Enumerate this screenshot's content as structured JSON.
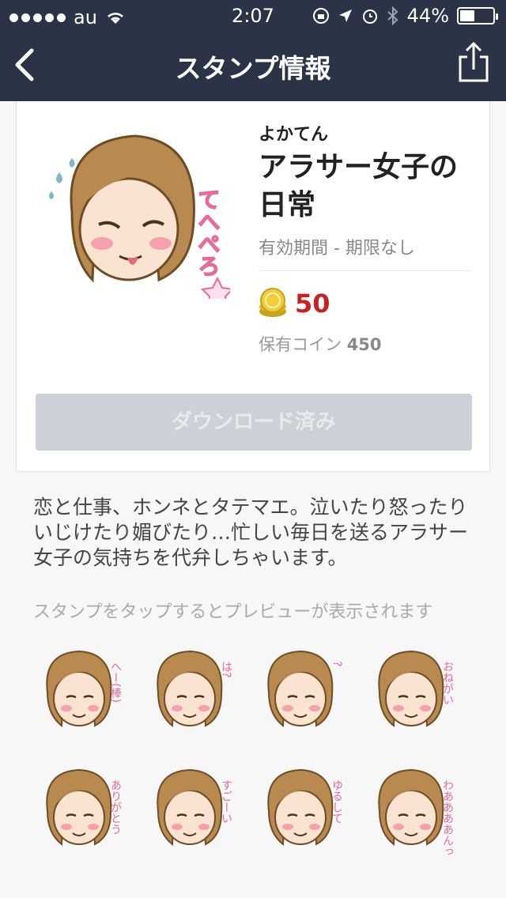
{
  "status_bar": {
    "carrier": "au",
    "time": "2:07",
    "battery": "44%",
    "battery_level": 0.44
  },
  "nav": {
    "title": "スタンプ情報",
    "back_icon": "chevron-left-icon",
    "share_icon": "share-icon"
  },
  "sticker": {
    "author": "よかてん",
    "title": "アラサー女子の日常",
    "validity": "有効期間 - 期限なし",
    "price": "50",
    "owned_label": "保有コイン",
    "owned_value": "450",
    "download_button": "ダウンロード済み",
    "hero_caption": "てへぺろ"
  },
  "description": "恋と仕事、ホンネとタテマエ。泣いたり怒ったりいじけたり媚びたり…忙しい毎日を送るアラサー女子の気持ちを代弁しちゃいます。",
  "preview_hint": "スタンプをタップするとプレビューが表示されます",
  "stickers": [
    {
      "caption": "へー(棒)"
    },
    {
      "caption": "は?"
    },
    {
      "caption": "?"
    },
    {
      "caption": "おねがい"
    },
    {
      "caption": "ありがとう"
    },
    {
      "caption": "すごーい"
    },
    {
      "caption": "ゆるして"
    },
    {
      "caption": "わああああんっ"
    }
  ],
  "colors": {
    "nav_bg": "#2a3446",
    "price": "#cc1f1f",
    "hair": "#b98a4f",
    "skin": "#fbe3d2",
    "cheek": "#f4a0ad",
    "accent_pink": "#e66b9a"
  }
}
